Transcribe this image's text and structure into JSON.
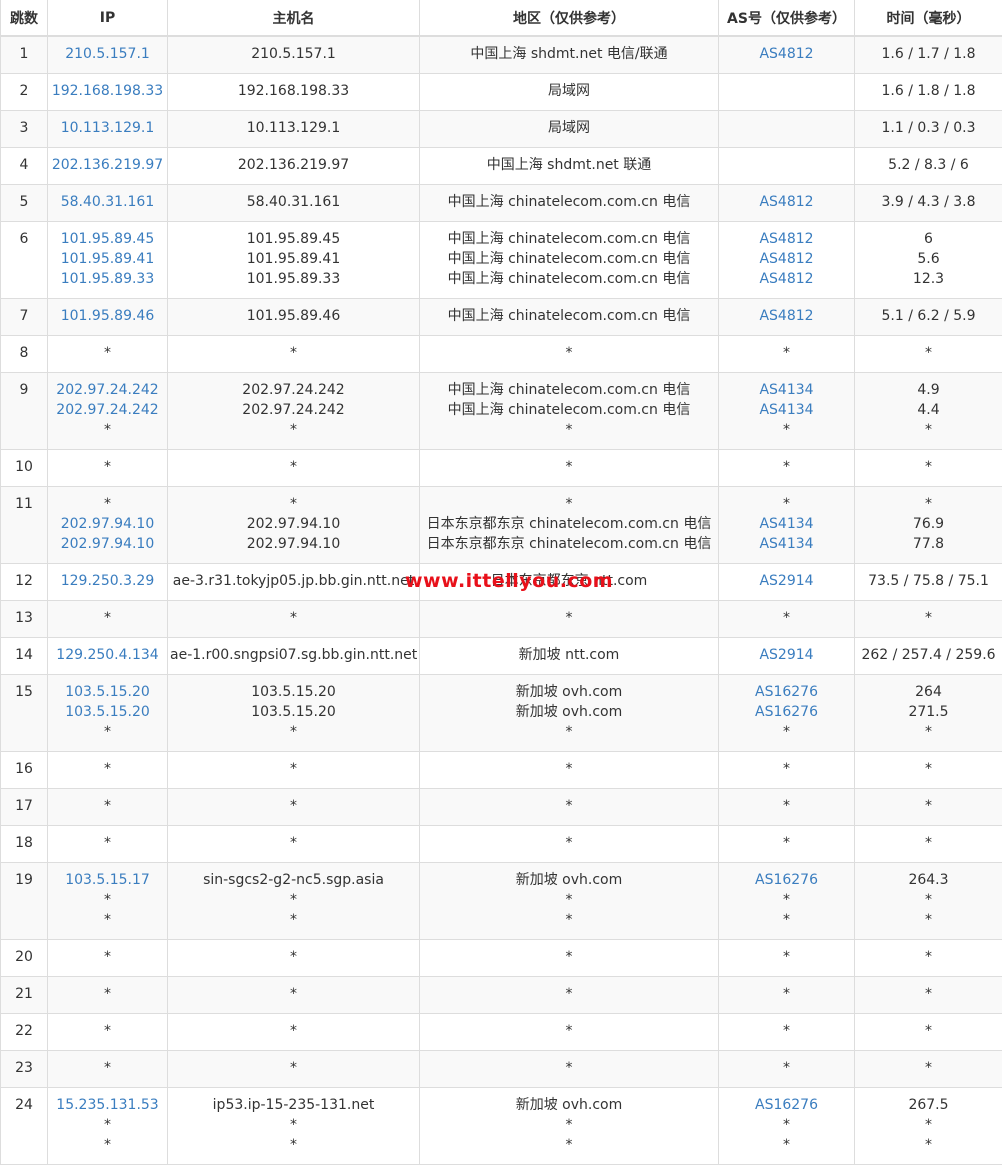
{
  "headers": {
    "hop": "跳数",
    "ip": "IP",
    "host": "主机名",
    "location": "地区（仅供参考）",
    "as": "AS号（仅供参考）",
    "time": "时间（毫秒）"
  },
  "rows": [
    {
      "hop": "1",
      "ip": [
        "210.5.157.1"
      ],
      "host": [
        "210.5.157.1"
      ],
      "location": [
        "中国上海 shdmt.net 电信/联通"
      ],
      "as": [
        "AS4812"
      ],
      "time": [
        "1.6 / 1.7 / 1.8"
      ]
    },
    {
      "hop": "2",
      "ip": [
        "192.168.198.33"
      ],
      "host": [
        "192.168.198.33"
      ],
      "location": [
        "局域网"
      ],
      "as": [
        ""
      ],
      "time": [
        "1.6 / 1.8 / 1.8"
      ]
    },
    {
      "hop": "3",
      "ip": [
        "10.113.129.1"
      ],
      "host": [
        "10.113.129.1"
      ],
      "location": [
        "局域网"
      ],
      "as": [
        ""
      ],
      "time": [
        "1.1 / 0.3 / 0.3"
      ]
    },
    {
      "hop": "4",
      "ip": [
        "202.136.219.97"
      ],
      "host": [
        "202.136.219.97"
      ],
      "location": [
        "中国上海 shdmt.net 联通"
      ],
      "as": [
        ""
      ],
      "time": [
        "5.2 / 8.3 / 6"
      ]
    },
    {
      "hop": "5",
      "ip": [
        "58.40.31.161"
      ],
      "host": [
        "58.40.31.161"
      ],
      "location": [
        "中国上海 chinatelecom.com.cn 电信"
      ],
      "as": [
        "AS4812"
      ],
      "time": [
        "3.9 / 4.3 / 3.8"
      ]
    },
    {
      "hop": "6",
      "ip": [
        "101.95.89.45",
        "101.95.89.41",
        "101.95.89.33"
      ],
      "host": [
        "101.95.89.45",
        "101.95.89.41",
        "101.95.89.33"
      ],
      "location": [
        "中国上海 chinatelecom.com.cn 电信",
        "中国上海 chinatelecom.com.cn 电信",
        "中国上海 chinatelecom.com.cn 电信"
      ],
      "as": [
        "AS4812",
        "AS4812",
        "AS4812"
      ],
      "time": [
        "6",
        "5.6",
        "12.3"
      ]
    },
    {
      "hop": "7",
      "ip": [
        "101.95.89.46"
      ],
      "host": [
        "101.95.89.46"
      ],
      "location": [
        "中国上海 chinatelecom.com.cn 电信"
      ],
      "as": [
        "AS4812"
      ],
      "time": [
        "5.1 / 6.2 / 5.9"
      ]
    },
    {
      "hop": "8",
      "ip": [
        "*"
      ],
      "host": [
        "*"
      ],
      "location": [
        "*"
      ],
      "as": [
        "*"
      ],
      "time": [
        "*"
      ]
    },
    {
      "hop": "9",
      "ip": [
        "202.97.24.242",
        "202.97.24.242",
        "*"
      ],
      "host": [
        "202.97.24.242",
        "202.97.24.242",
        "*"
      ],
      "location": [
        "中国上海 chinatelecom.com.cn 电信",
        "中国上海 chinatelecom.com.cn 电信",
        "*"
      ],
      "as": [
        "AS4134",
        "AS4134",
        "*"
      ],
      "time": [
        "4.9",
        "4.4",
        "*"
      ]
    },
    {
      "hop": "10",
      "ip": [
        "*"
      ],
      "host": [
        "*"
      ],
      "location": [
        "*"
      ],
      "as": [
        "*"
      ],
      "time": [
        "*"
      ]
    },
    {
      "hop": "11",
      "ip": [
        "*",
        "202.97.94.10",
        "202.97.94.10"
      ],
      "host": [
        "*",
        "202.97.94.10",
        "202.97.94.10"
      ],
      "location": [
        "*",
        "日本东京都东京 chinatelecom.com.cn 电信",
        "日本东京都东京 chinatelecom.com.cn 电信"
      ],
      "as": [
        "*",
        "AS4134",
        "AS4134"
      ],
      "time": [
        "*",
        "76.9",
        "77.8"
      ]
    },
    {
      "hop": "12",
      "ip": [
        "129.250.3.29"
      ],
      "host": [
        "ae-3.r31.tokyjp05.jp.bb.gin.ntt.net"
      ],
      "location": [
        "日本东京都东京 ntt.com"
      ],
      "as": [
        "AS2914"
      ],
      "time": [
        "73.5 / 75.8 / 75.1"
      ]
    },
    {
      "hop": "13",
      "ip": [
        "*"
      ],
      "host": [
        "*"
      ],
      "location": [
        "*"
      ],
      "as": [
        "*"
      ],
      "time": [
        "*"
      ]
    },
    {
      "hop": "14",
      "ip": [
        "129.250.4.134"
      ],
      "host": [
        "ae-1.r00.sngpsi07.sg.bb.gin.ntt.net"
      ],
      "location": [
        "新加坡 ntt.com"
      ],
      "as": [
        "AS2914"
      ],
      "time": [
        "262 / 257.4 / 259.6"
      ]
    },
    {
      "hop": "15",
      "ip": [
        "103.5.15.20",
        "103.5.15.20",
        "*"
      ],
      "host": [
        "103.5.15.20",
        "103.5.15.20",
        "*"
      ],
      "location": [
        "新加坡 ovh.com",
        "新加坡 ovh.com",
        "*"
      ],
      "as": [
        "AS16276",
        "AS16276",
        "*"
      ],
      "time": [
        "264",
        "271.5",
        "*"
      ]
    },
    {
      "hop": "16",
      "ip": [
        "*"
      ],
      "host": [
        "*"
      ],
      "location": [
        "*"
      ],
      "as": [
        "*"
      ],
      "time": [
        "*"
      ]
    },
    {
      "hop": "17",
      "ip": [
        "*"
      ],
      "host": [
        "*"
      ],
      "location": [
        "*"
      ],
      "as": [
        "*"
      ],
      "time": [
        "*"
      ]
    },
    {
      "hop": "18",
      "ip": [
        "*"
      ],
      "host": [
        "*"
      ],
      "location": [
        "*"
      ],
      "as": [
        "*"
      ],
      "time": [
        "*"
      ]
    },
    {
      "hop": "19",
      "ip": [
        "103.5.15.17",
        "*",
        "*"
      ],
      "host": [
        "sin-sgcs2-g2-nc5.sgp.asia",
        "*",
        "*"
      ],
      "location": [
        "新加坡 ovh.com",
        "*",
        "*"
      ],
      "as": [
        "AS16276",
        "*",
        "*"
      ],
      "time": [
        "264.3",
        "*",
        "*"
      ]
    },
    {
      "hop": "20",
      "ip": [
        "*"
      ],
      "host": [
        "*"
      ],
      "location": [
        "*"
      ],
      "as": [
        "*"
      ],
      "time": [
        "*"
      ]
    },
    {
      "hop": "21",
      "ip": [
        "*"
      ],
      "host": [
        "*"
      ],
      "location": [
        "*"
      ],
      "as": [
        "*"
      ],
      "time": [
        "*"
      ]
    },
    {
      "hop": "22",
      "ip": [
        "*"
      ],
      "host": [
        "*"
      ],
      "location": [
        "*"
      ],
      "as": [
        "*"
      ],
      "time": [
        "*"
      ]
    },
    {
      "hop": "23",
      "ip": [
        "*"
      ],
      "host": [
        "*"
      ],
      "location": [
        "*"
      ],
      "as": [
        "*"
      ],
      "time": [
        "*"
      ]
    },
    {
      "hop": "24",
      "ip": [
        "15.235.131.53",
        "*",
        "*"
      ],
      "host": [
        "ip53.ip-15-235-131.net",
        "*",
        "*"
      ],
      "location": [
        "新加坡 ovh.com",
        "*",
        "*"
      ],
      "as": [
        "AS16276",
        "*",
        "*"
      ],
      "time": [
        "267.5",
        "*",
        "*"
      ]
    }
  ],
  "watermark": "www.ittellyou.com",
  "colors": {
    "link": "#3a7dbf",
    "text": "#333333",
    "border": "#dddddd",
    "stripe": "#f9f9f9",
    "watermark": "#e8101a"
  }
}
